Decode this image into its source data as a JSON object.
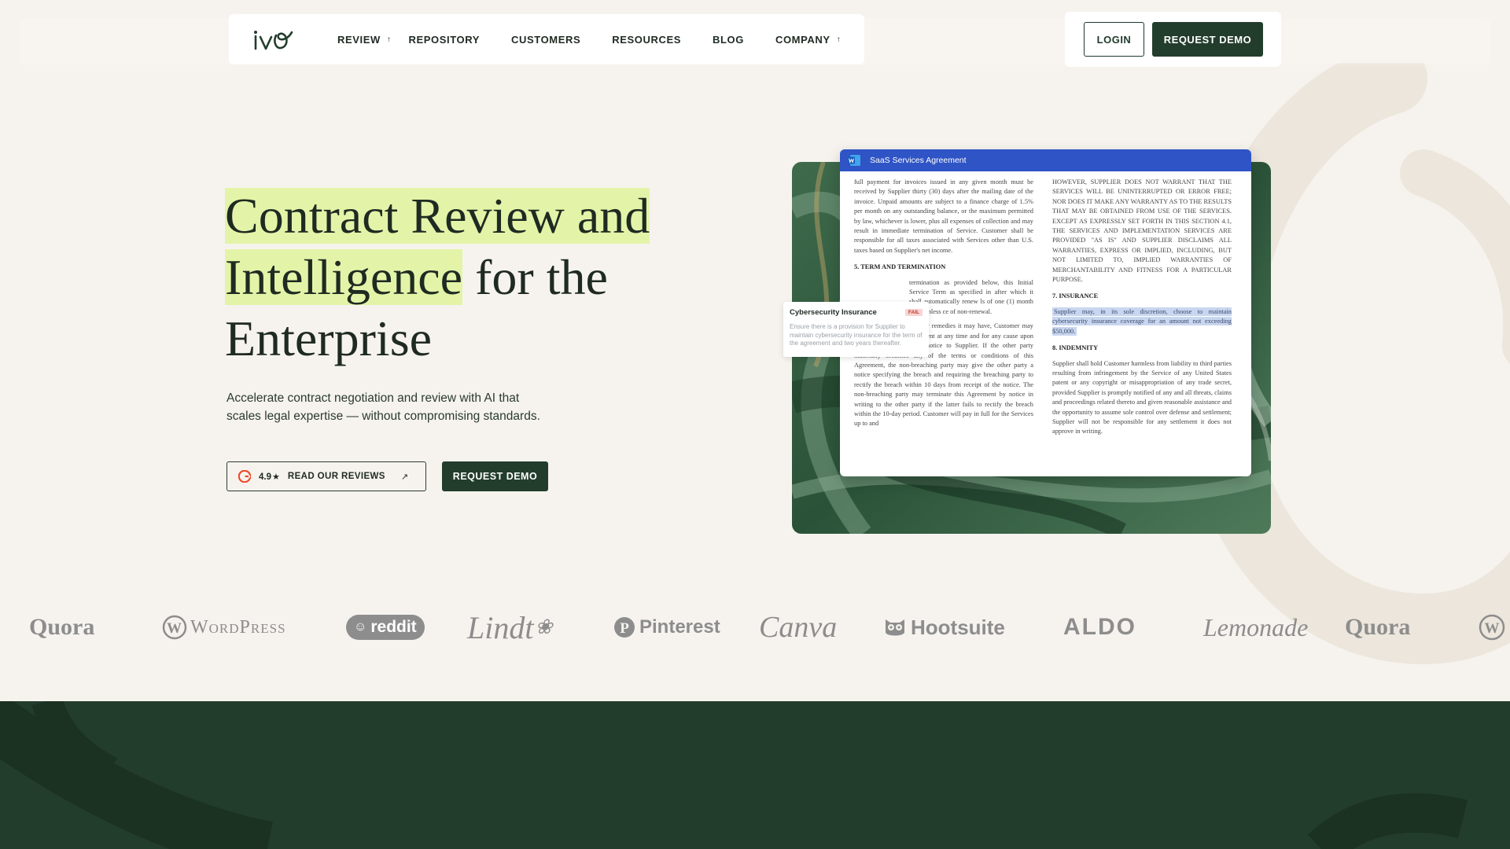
{
  "brand": {
    "logo_text": "ivo"
  },
  "nav": {
    "items": [
      {
        "label": "REVIEW",
        "has_chevron": true
      },
      {
        "label": "REPOSITORY",
        "has_chevron": false
      },
      {
        "label": "CUSTOMERS",
        "has_chevron": false
      },
      {
        "label": "RESOURCES",
        "has_chevron": false
      },
      {
        "label": "BLOG",
        "has_chevron": false
      },
      {
        "label": "COMPANY",
        "has_chevron": true
      }
    ],
    "login_label": "LOGIN",
    "request_demo_label": "REQUEST DEMO"
  },
  "hero": {
    "title_highlight_1": "Contract Review and",
    "title_highlight_2": "Intelligence",
    "title_rest_1": " for the",
    "title_rest_2": "Enterprise",
    "subtitle": "Accelerate contract negotiation and review with AI that scales legal expertise — without compromising standards.",
    "rating": "4.9",
    "reviews_label": "READ OUR REVIEWS",
    "cta_label": "REQUEST DEMO"
  },
  "document": {
    "title": "SaaS Services Agreement",
    "left_col_intro": "full payment for invoices issued in any given month must be received by Supplier thirty (30) days after the mailing date of the invoice. Unpaid amounts are subject to a finance charge of 1.5% per month on any outstanding balance, or the maximum permitted by law, whichever is lower, plus all expenses of collection and may result in immediate termination of Service. Customer shall be responsible for all taxes associated with Services other than U.S. taxes based on Supplier's net income.",
    "left_heading": "5. TERM AND TERMINATION",
    "left_col_p2": "termination as provided below, this Initial Service Term as specified in after which it shall automatically renew ls of one (1) month each, unless ce of non-renewal.",
    "left_col_p3": "5.2 In addition to any other remedies it may have, Customer may also terminate this Agreement at any time and for any cause upon thirty (30) days' written notice to Supplier. If the other party materially breaches any of the terms or conditions of this Agreement, the non-breaching party may give the other party a notice specifying the breach and requiring the breaching party to rectify the breach within 10 days from receipt of the notice. The non-breaching party may terminate this Agreement by notice in writing to the other party if the latter fails to rectify the breach within the 10-day period. Customer will pay in full for the Services up to and",
    "right_col_intro": "HOWEVER, SUPPLIER DOES NOT WARRANT THAT THE SERVICES WILL BE UNINTERRUPTED OR ERROR FREE; NOR DOES IT MAKE ANY WARRANTY AS TO THE RESULTS THAT MAY BE OBTAINED FROM USE OF THE SERVICES. EXCEPT AS EXPRESSLY SET FORTH IN THIS SECTION 4.1, THE SERVICES AND IMPLEMENTATION SERVICES ARE PROVIDED \"AS IS\" AND SUPPLIER DISCLAIMS ALL WARRANTIES, EXPRESS OR IMPLIED, INCLUDING, BUT NOT LIMITED TO, IMPLIED WARRANTIES OF MERCHANTABILITY AND FITNESS FOR A PARTICULAR PURPOSE.",
    "insurance_heading": "7. INSURANCE",
    "insurance_text": "Supplier may, in its sole discretion, choose to maintain cybersecurity insurance coverage for an amount not exceeding $50,000.",
    "indemnity_heading": "8. INDEMNITY",
    "indemnity_text": "Supplier shall hold Customer harmless from liability to third parties resulting from infringement by the Service of any United States patent or any copyright or misappropriation of any trade secret, provided Supplier is promptly notified of any and all threats, claims and proceedings related thereto and given reasonable assistance and the opportunity to assume sole control over defense and settlement; Supplier will not be responsible for any settlement it does not approve in writing."
  },
  "flag_card": {
    "title": "Cybersecurity Insurance",
    "badge": "FAIL",
    "description": "Ensure there is a provision for Supplier to maintain cybersecurity insurance for the term of the agreement and two years thereafter."
  },
  "logos": [
    {
      "name": "Quora"
    },
    {
      "name": "WordPress"
    },
    {
      "name": "reddit"
    },
    {
      "name": "Lindt"
    },
    {
      "name": "Pinterest"
    },
    {
      "name": "Canva"
    },
    {
      "name": "Hootsuite"
    },
    {
      "name": "ALDO"
    },
    {
      "name": "Lemonade"
    },
    {
      "name": "Quora"
    },
    {
      "name": "W"
    }
  ],
  "colors": {
    "brand_dark": "#233d2c",
    "highlight": "#e3f4a8",
    "page_bg": "#f6f3ee",
    "word_blue": "#2f54c6"
  }
}
